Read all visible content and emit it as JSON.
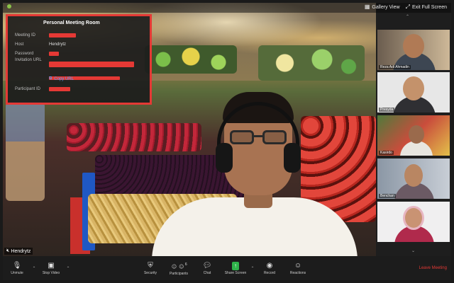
{
  "topbar": {
    "gallery_view": "Gallery View",
    "exit_fullscreen": "Exit Full Screen"
  },
  "info_panel": {
    "title": "Personal Meeting Room",
    "rows": [
      {
        "label": "Meeting ID",
        "value": ""
      },
      {
        "label": "Host",
        "value": "Hendrytz"
      },
      {
        "label": "Password",
        "value": ""
      },
      {
        "label": "Invitation URL",
        "value": ""
      },
      {
        "label": "Participant ID",
        "value": ""
      }
    ],
    "copy_url": "Copy URL"
  },
  "main_video": {
    "name": "Hendrytz"
  },
  "gallery": {
    "tiles": [
      {
        "name": "Reza Adi Ahmadin"
      },
      {
        "name": "Presyda"
      },
      {
        "name": "Kasirdo"
      },
      {
        "name": "Benchan"
      },
      {
        "name": ""
      }
    ]
  },
  "toolbar": {
    "items": [
      {
        "label": "Unmute",
        "icon": "microphone-icon"
      },
      {
        "label": "Stop Video",
        "icon": "video-camera-icon"
      },
      {
        "label": "Security",
        "icon": "shield-icon"
      },
      {
        "label": "Participants",
        "icon": "people-icon",
        "count": "6"
      },
      {
        "label": "Chat",
        "icon": "chat-icon"
      },
      {
        "label": "Share Screen",
        "icon": "share-screen-icon"
      },
      {
        "label": "Record",
        "icon": "record-icon"
      },
      {
        "label": "Reactions",
        "icon": "smiley-icon"
      }
    ],
    "leave": "Leave Meeting"
  },
  "colors": {
    "accent_red": "#e53935",
    "share_green": "#2eb34a",
    "link_blue": "#4fa3ff"
  }
}
